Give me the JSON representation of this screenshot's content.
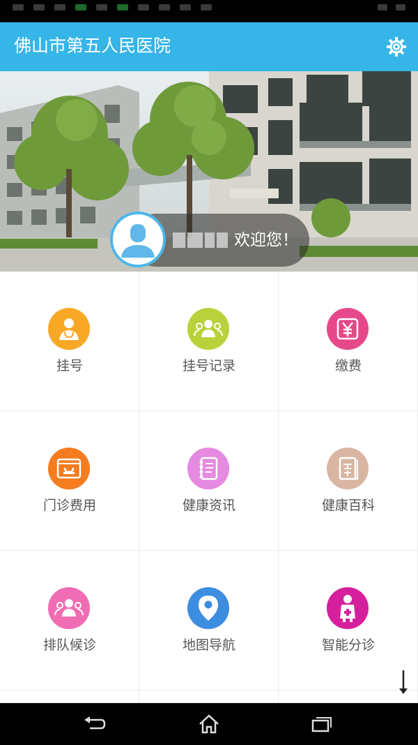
{
  "app": {
    "title": "佛山市第五人民医院",
    "accent_color": "#35b5e8",
    "settings_icon": "gear-icon"
  },
  "banner": {
    "welcome_text": "欢迎您！",
    "user_name": "(pixelated name)",
    "avatar_icon": "user-avatar-icon"
  },
  "menu": {
    "items": [
      {
        "label": "挂号",
        "icon": "doctor-icon",
        "color": "#f9a825"
      },
      {
        "label": "挂号记录",
        "icon": "people-icon",
        "color": "#b9d23c"
      },
      {
        "label": "缴费",
        "icon": "yen-payment-icon",
        "color": "#e6488a"
      },
      {
        "label": "门诊费用",
        "icon": "bill-icon",
        "color": "#f57c1f"
      },
      {
        "label": "健康资讯",
        "icon": "notebook-icon",
        "color": "#e58ae0"
      },
      {
        "label": "健康百科",
        "icon": "encyclopedia-icon",
        "color": "#d9b5a3"
      },
      {
        "label": "排队候诊",
        "icon": "queue-icon",
        "color": "#f06db3"
      },
      {
        "label": "地图导航",
        "icon": "map-pin-icon",
        "color": "#3d8de0"
      },
      {
        "label": "智能分诊",
        "icon": "nurse-icon",
        "color": "#d61f9d"
      }
    ]
  },
  "nav": {
    "back_icon": "back-icon",
    "home_icon": "home-icon",
    "recents_icon": "recents-icon"
  }
}
